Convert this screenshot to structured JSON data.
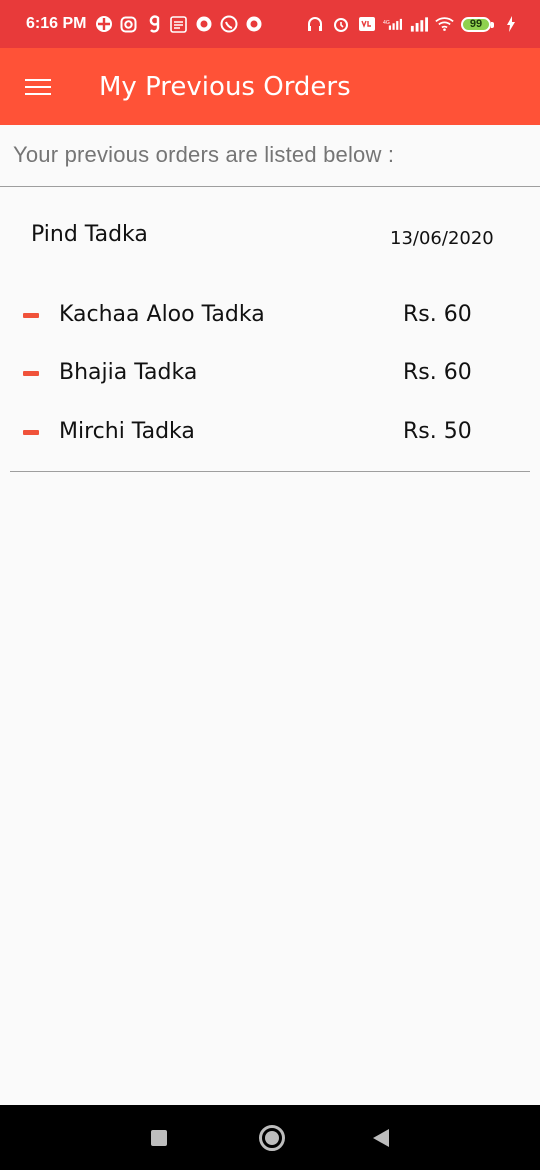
{
  "status_bar": {
    "time": "6:16 PM",
    "battery": "99",
    "network_label": "4G",
    "volte_label": "Vo LTE",
    "left_icons": [
      "unknown-app-icon",
      "instagram-icon",
      "g-app-icon",
      "news-icon",
      "circle-app-icon",
      "whatsapp-icon",
      "circle-app-icon"
    ],
    "right_icons": [
      "headphones-icon",
      "alarm-icon",
      "volte-icon",
      "signal-icon",
      "signal-icon",
      "wifi-icon",
      "battery-icon",
      "charging-icon"
    ]
  },
  "app_bar": {
    "title": "My Previous Orders",
    "menu_icon": "hamburger-menu-icon"
  },
  "subtitle": "Your previous orders are listed below :",
  "orders": [
    {
      "restaurant": "Pind Tadka",
      "date": "13/06/2020",
      "items": [
        {
          "name": "Kachaa Aloo Tadka",
          "price": "Rs. 60"
        },
        {
          "name": "Bhajia Tadka",
          "price": "Rs. 60"
        },
        {
          "name": "Mirchi Tadka",
          "price": "Rs. 50"
        }
      ]
    }
  ],
  "nav_bar": {
    "icons": [
      "recents-square-icon",
      "home-circle-icon",
      "back-triangle-icon"
    ]
  },
  "colors": {
    "status_bar": "#e83a3a",
    "app_bar": "#ff5237",
    "accent_dash": "#f0523a",
    "background": "#fafafa"
  }
}
